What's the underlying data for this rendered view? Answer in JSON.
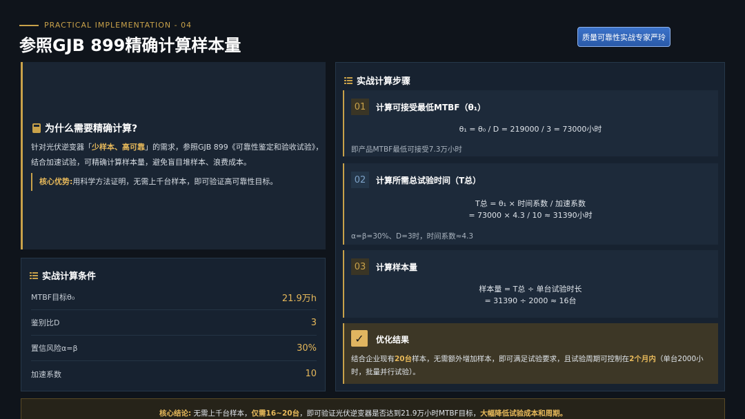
{
  "header": {
    "kicker": "PRACTICAL IMPLEMENTATION - 04",
    "title": "参照GJB 899精确计算样本量",
    "badge": "质量可靠性实战专家严玲"
  },
  "why": {
    "heading": "为什么需要精确计算?",
    "body_pre": "针对光伏逆变器「",
    "body_hl": "少样本、高可靠",
    "body_post": "」的需求，参照GJB 899《可靠性鉴定和验收试验》，结合加速试验，可精确计算样本量，避免盲目堆样本、浪费成本。",
    "adv_key": "核心优势:",
    "adv_text": "用科学方法证明，无需上千台样本，即可验证高可靠性目标。"
  },
  "conditions": {
    "heading": "实战计算条件",
    "rows": [
      {
        "label": "MTBF目标θ₀",
        "value": "21.9万h"
      },
      {
        "label": "鉴别比D",
        "value": "3"
      },
      {
        "label": "置信风险α=β",
        "value": "30%"
      },
      {
        "label": "加速系数",
        "value": "10"
      }
    ]
  },
  "steps": {
    "heading": "实战计算步骤",
    "items": [
      {
        "num": "01",
        "title": "计算可接受最低MTBF（θ₁）",
        "f1": "θ₁ = θ₀ / D = 219000 / 3 = 73000小时",
        "f2": "",
        "note": "即产品MTBF最低可接受7.3万小时"
      },
      {
        "num": "02",
        "title": "计算所需总试验时间（T总）",
        "f1": "T总 = θ₁ × 时间系数 / 加速系数",
        "f2": "= 73000 × 4.3 / 10 ≈ 31390小时",
        "note": "α=β=30%、D=3时，时间系数≈4.3"
      },
      {
        "num": "03",
        "title": "计算样本量",
        "f1": "样本量 = T总 ÷ 单台试验时长",
        "f2": "= 31390 ÷ 2000 ≈ 16台",
        "note": ""
      }
    ],
    "result": {
      "title": "优化结果",
      "check": "✓",
      "t1": "结合企业现有",
      "h1": "20台",
      "t2": "样本，无需额外增加样本，即可满足试验要求，且试验周期可控制在",
      "h2": "2个月内",
      "t3": "（单台2000小时，批量并行试验）。"
    }
  },
  "conclusion": {
    "key": "核心结论:",
    "t1": "无需上千台样本，",
    "h1": "仅需16~20台",
    "t2": "，即可验证光伏逆变器是否达到21.9万小时MTBF目标，",
    "h2": "大幅降低试验成本和周期。"
  },
  "colors": {
    "accent": "#c9a24a",
    "bg": "#0f141b",
    "panel": "#172230"
  }
}
